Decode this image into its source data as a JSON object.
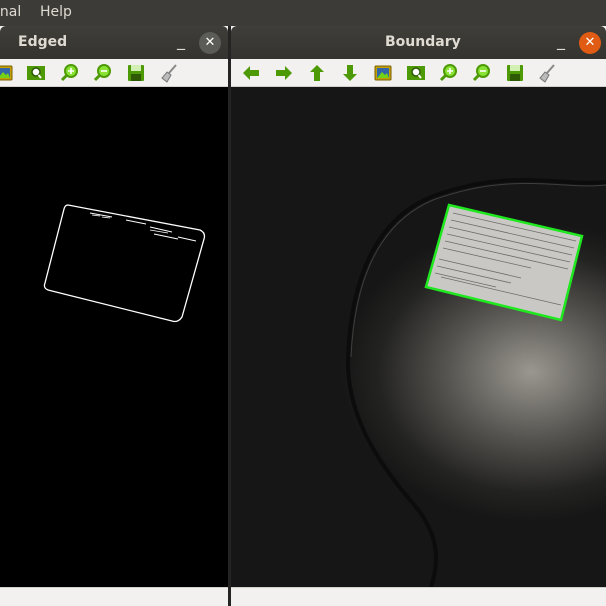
{
  "menubar": {
    "terminal_label": "inal",
    "help_label": "Help"
  },
  "windows": {
    "left": {
      "title": "Edged",
      "minimize": "_",
      "close": "✕",
      "close_color": "#5b5b58"
    },
    "right": {
      "title": "Boundary",
      "minimize": "_",
      "close": "✕",
      "close_color": "#e05c14"
    }
  },
  "toolbar_icons": [
    "arrow-left-icon",
    "arrow-right-icon",
    "arrow-up-icon",
    "arrow-down-icon",
    "image-icon",
    "zoom-fit-icon",
    "zoom-in-icon",
    "zoom-out-icon",
    "save-icon",
    "broom-icon"
  ],
  "colors": {
    "icon_green": "#4e9a06",
    "contour_green": "#1fe81f",
    "edge_white": "#ffffff"
  }
}
